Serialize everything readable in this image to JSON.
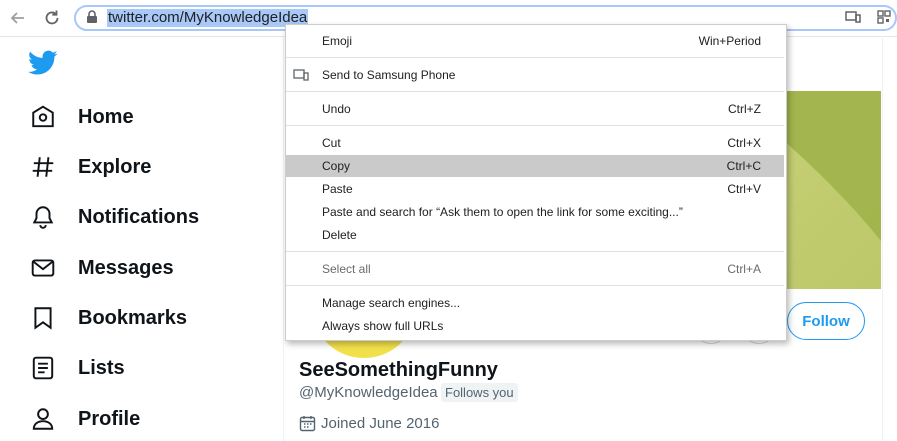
{
  "browser": {
    "url": "twitter.com/MyKnowledgeIdea"
  },
  "sidebar": {
    "items": [
      {
        "label": "Home",
        "icon": "home-icon"
      },
      {
        "label": "Explore",
        "icon": "hashtag-icon"
      },
      {
        "label": "Notifications",
        "icon": "bell-icon"
      },
      {
        "label": "Messages",
        "icon": "envelope-icon"
      },
      {
        "label": "Bookmarks",
        "icon": "bookmark-icon"
      },
      {
        "label": "Lists",
        "icon": "list-icon"
      },
      {
        "label": "Profile",
        "icon": "person-icon"
      }
    ]
  },
  "profile": {
    "display_name": "SeeSomethingFunny",
    "handle": "@MyKnowledgeIdea",
    "follows_you": "Follows you",
    "joined": "Joined June 2016",
    "follow_label": "Follow"
  },
  "context_menu": {
    "emoji": {
      "label": "Emoji",
      "shortcut": "Win+Period"
    },
    "send_phone": {
      "label": "Send to Samsung Phone"
    },
    "undo": {
      "label": "Undo",
      "shortcut": "Ctrl+Z"
    },
    "cut": {
      "label": "Cut",
      "shortcut": "Ctrl+X"
    },
    "copy": {
      "label": "Copy",
      "shortcut": "Ctrl+C"
    },
    "paste": {
      "label": "Paste",
      "shortcut": "Ctrl+V"
    },
    "paste_search": {
      "label": "Paste and search for “Ask them to open the link for some exciting...”"
    },
    "delete": {
      "label": "Delete"
    },
    "select_all": {
      "label": "Select all",
      "shortcut": "Ctrl+A"
    },
    "manage_engines": {
      "label": "Manage search engines..."
    },
    "show_urls": {
      "label": "Always show full URLs"
    }
  },
  "colors": {
    "twitter_blue": "#1d9bf0",
    "menu_highlight": "#cacaca",
    "url_selection": "#a8c8f8"
  }
}
